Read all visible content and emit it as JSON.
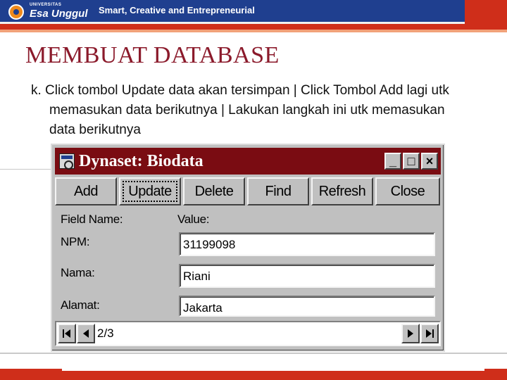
{
  "banner": {
    "brand_small": "UNIVERSITAS",
    "brand": "Esa Unggul",
    "tagline": "Smart, Creative and Entrepreneurial"
  },
  "slide": {
    "title": "MEMBUAT  DATABASE",
    "bullet": "k. Click  tombol Update  data akan tersimpan  |  Click Tombol Add lagi utk memasukan data berikutnya | Lakukan langkah ini  utk memasukan data berikutnya"
  },
  "dialog": {
    "title": "Dynaset: Biodata",
    "window_buttons": {
      "minimize": "_",
      "maximize": "□",
      "close": "×"
    },
    "buttons": [
      {
        "label": "Add"
      },
      {
        "label": "Update"
      },
      {
        "label": "Delete"
      },
      {
        "label": "Find"
      },
      {
        "label": "Refresh"
      },
      {
        "label": "Close"
      }
    ],
    "header_field_name": "Field Name:",
    "header_value": "Value:",
    "fields": [
      {
        "label": "NPM:",
        "value": "31199098"
      },
      {
        "label": "Nama:",
        "value": "Riani"
      },
      {
        "label": "Alamat:",
        "value": "Jakarta"
      }
    ],
    "record_position": "2/3"
  }
}
